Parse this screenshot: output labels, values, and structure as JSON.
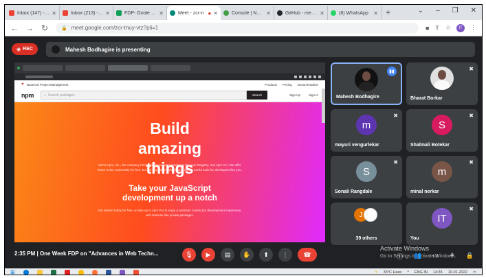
{
  "browser": {
    "tabs": [
      {
        "label": "Inbox (147) - rich",
        "color": "#ea4335"
      },
      {
        "label": "Inbox (213) - bhu",
        "color": "#ea4335"
      },
      {
        "label": "FDP- Goole meet",
        "color": "#0f9d58"
      },
      {
        "label": "Meet - zcr-n",
        "color": "#00897b",
        "active": true
      },
      {
        "label": "Console | Node.j",
        "color": "#43a047"
      },
      {
        "label": "GitHub - meena",
        "color": "#24292e"
      },
      {
        "label": "(8) WhatsApp",
        "color": "#25d366"
      }
    ],
    "url": "meet.google.com/zcr-tnuy-vtz?pli=1",
    "profile_initials": "IT"
  },
  "meet": {
    "rec_label": "REC",
    "presenting_text": "Mahesh Bodhagire is presenting",
    "meeting_time": "2:35 PM",
    "meeting_title": "One Week FDP on \"Advances in Web Techn...",
    "watermark_title": "Activate Windows",
    "watermark_sub": "Go to Settings to activate Windows.",
    "participants": [
      {
        "name": "Mahesh Bodhagire",
        "type": "photo",
        "presenting": true
      },
      {
        "name": "Bharat Borkar",
        "type": "photo"
      },
      {
        "name": "mayuri vengurlekar",
        "initial": "m",
        "color": "#5e35b1"
      },
      {
        "name": "Shalmali Botekar",
        "initial": "S",
        "color": "#d81b60"
      },
      {
        "name": "Sonali Rangdale",
        "initial": "S",
        "color": "#78909c"
      },
      {
        "name": "minal nerkar",
        "initial": "m",
        "color": "#795548"
      },
      {
        "name": "39 others",
        "initial": "J",
        "color": "#e37400"
      },
      {
        "name": "You",
        "initial": "IT",
        "color": "#7e57c2"
      }
    ]
  },
  "presentation": {
    "npm_tagline": "Nuanced Project Management",
    "nav_links": [
      "Products",
      "Pricing",
      "Documentation"
    ],
    "logo": "npm",
    "search_placeholder": "Search packages",
    "search_button": "Search",
    "signup": "Sign Up",
    "signin": "Sign In",
    "hero_title": "Build amazing things",
    "hero_text": "We're npm, Inc., the company behind Node package manager, the npm Registry, and npm CLI. We offer those to the community for free, but our day job is building and selling useful tools for developers like you.",
    "hero_subtitle": "Take your JavaScript development up a notch",
    "hero_text2": "Get started today for free, or step up to npm Pro to enjoy a premium JavaScript development experience, with features like private packages."
  },
  "taskbar": {
    "weather": "33°C Haze",
    "lang": "ENG IN",
    "time": "14:35",
    "date": "10-01-2022"
  }
}
